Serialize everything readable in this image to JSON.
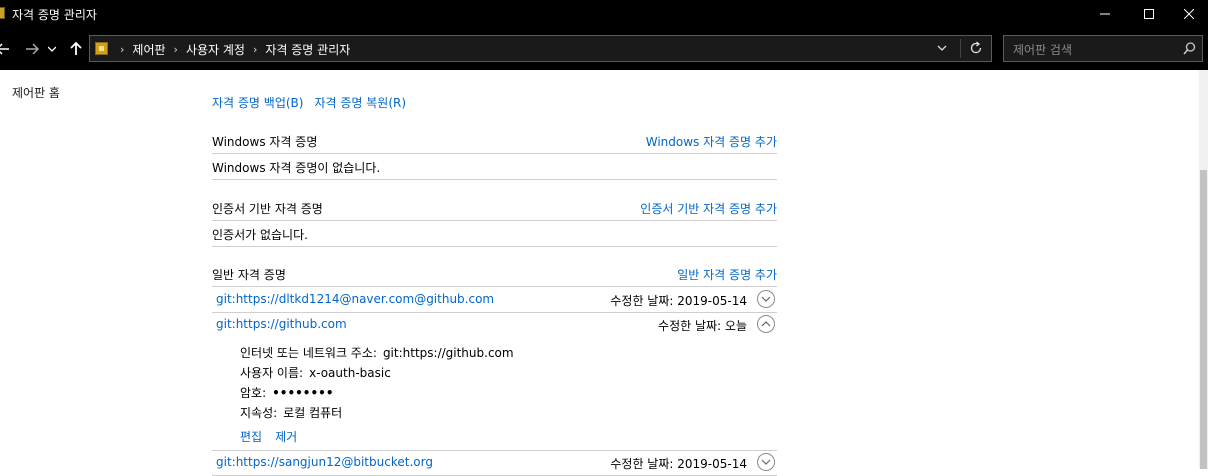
{
  "window": {
    "title": "자격 증명 관리자"
  },
  "address": {
    "breadcrumbs": [
      "제어판",
      "사용자 계정",
      "자격 증명 관리자"
    ]
  },
  "search": {
    "placeholder": "제어판 검색"
  },
  "sidebar": {
    "home": "제어판 홈"
  },
  "top_links": {
    "backup": "자격 증명 백업(B)",
    "restore": "자격 증명 복원(R)"
  },
  "sections": {
    "windows": {
      "title": "Windows 자격 증명",
      "add": "Windows 자격 증명 추가",
      "empty": "Windows 자격 증명이 없습니다."
    },
    "certificate": {
      "title": "인증서 기반 자격 증명",
      "add": "인증서 기반 자격 증명 추가",
      "empty": "인증서가 없습니다."
    },
    "generic": {
      "title": "일반 자격 증명",
      "add": "일반 자격 증명 추가"
    }
  },
  "credentials": [
    {
      "name": "git:https://dltkd1214@naver.com@github.com",
      "modified": "수정한 날짜:  2019-05-14"
    },
    {
      "name": "git:https://github.com",
      "modified": "수정한 날짜:  오늘"
    },
    {
      "name": "git:https://sangjun12@bitbucket.org",
      "modified": "수정한 날짜:  2019-05-14"
    }
  ],
  "details": {
    "address_label": "인터넷 또는 네트워크 주소:",
    "address_value": "git:https://github.com",
    "user_label": "사용자 이름:",
    "user_value": "x-oauth-basic",
    "password_label": "암호:",
    "password_value": "••••••••",
    "persistence_label": "지속성:",
    "persistence_value": "로컬 컴퓨터",
    "edit": "편집",
    "remove": "제거"
  }
}
